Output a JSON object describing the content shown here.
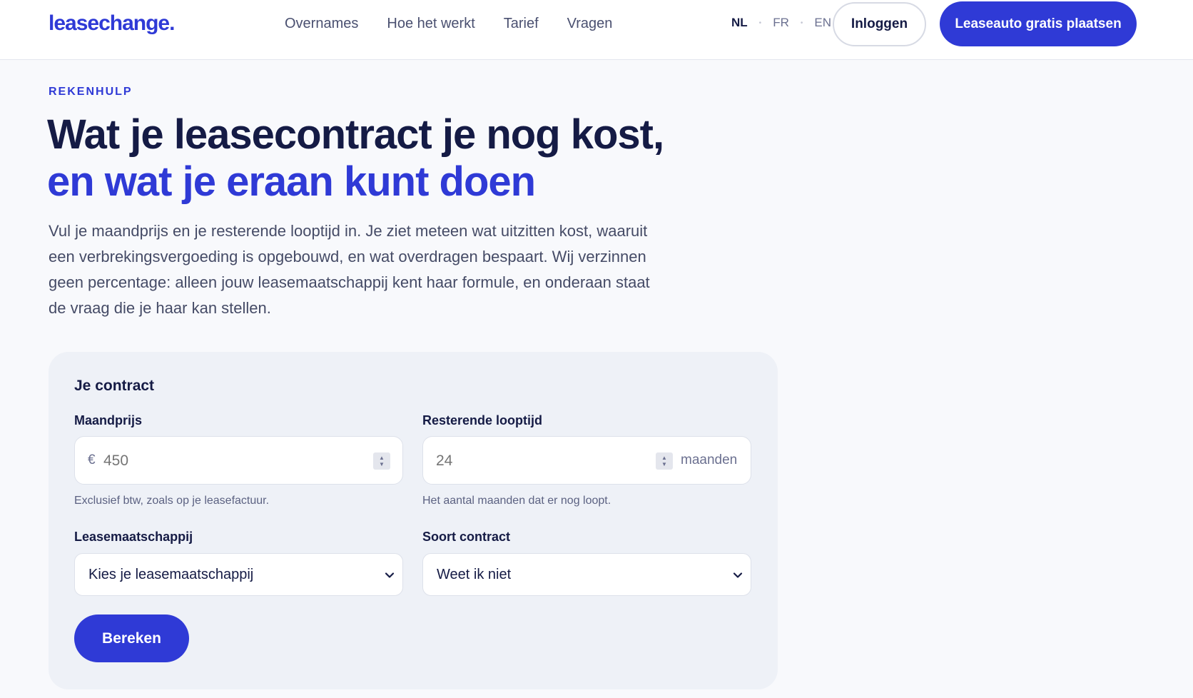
{
  "header": {
    "logo": "leasechange.",
    "nav": [
      "Overnames",
      "Hoe het werkt",
      "Tarief",
      "Vragen"
    ],
    "languages": [
      "NL",
      "FR",
      "EN"
    ],
    "active_language": "NL",
    "login_label": "Inloggen",
    "cta_label": "Leaseauto gratis plaatsen"
  },
  "hero": {
    "eyebrow": "REKENHULP",
    "headline_part1": "Wat je leasecontract je nog kost,",
    "headline_part2": "en wat je eraan kunt doen",
    "intro": "Vul je maandprijs en je resterende looptijd in. Je ziet meteen wat uitzitten kost, waaruit een verbrekingsvergoeding is opgebouwd, en wat overdragen bespaart. Wij verzinnen geen percentage: alleen jouw leasemaatschappij kent haar formule, en onderaan staat de vraag die je haar kan stellen."
  },
  "form": {
    "title": "Je contract",
    "monthly": {
      "label": "Maandprijs",
      "prefix": "€",
      "placeholder": "450",
      "helper": "Exclusief btw, zoals op je leasefactuur."
    },
    "term": {
      "label": "Resterende looptijd",
      "placeholder": "24",
      "suffix": "maanden",
      "helper": "Het aantal maanden dat er nog loopt."
    },
    "company": {
      "label": "Leasemaatschappij",
      "selected": "Kies je leasemaatschappij"
    },
    "contract_type": {
      "label": "Soort contract",
      "selected": "Weet ik niet"
    },
    "submit_label": "Bereken"
  },
  "colors": {
    "accent": "#2f3ad6",
    "text": "#151b45",
    "card_bg": "#eef1f7"
  }
}
